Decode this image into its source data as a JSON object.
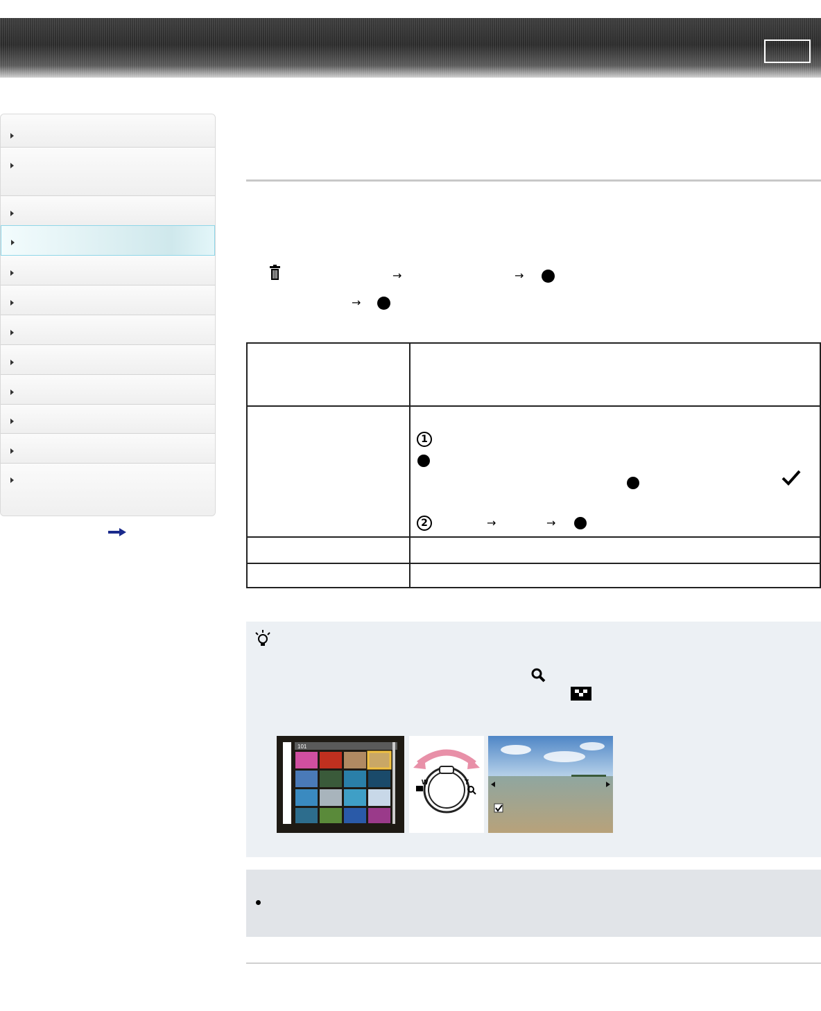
{
  "icons": {
    "nav_bullet": "triangle-right-icon",
    "more": "arrow-right-icon",
    "trash": "trash-icon",
    "hint": "lightbulb-icon",
    "zoom_tele": "magnifier-icon",
    "zoom_wide": "index-grid-icon",
    "check": "checkmark-icon",
    "step1": "circled-number-1-icon",
    "step2": "circled-number-2-icon",
    "bullet": "bullet-icon"
  },
  "glyphs": {
    "step1": "1",
    "step2": "2",
    "arrow": "→",
    "check": "✓",
    "bullet": "●"
  },
  "illustration": {
    "folder_label": "101",
    "dial_wide": "W",
    "dial_tele": "T"
  },
  "colors": {
    "active_nav": "#d9f3f7",
    "active_nav_border": "#8ed6e8",
    "hint_bg": "#ecf0f4",
    "note_bg": "#e1e4e8",
    "more_arrow": "#1a2a8c"
  },
  "navigation": {
    "item_count": 12,
    "active_index": 3
  }
}
